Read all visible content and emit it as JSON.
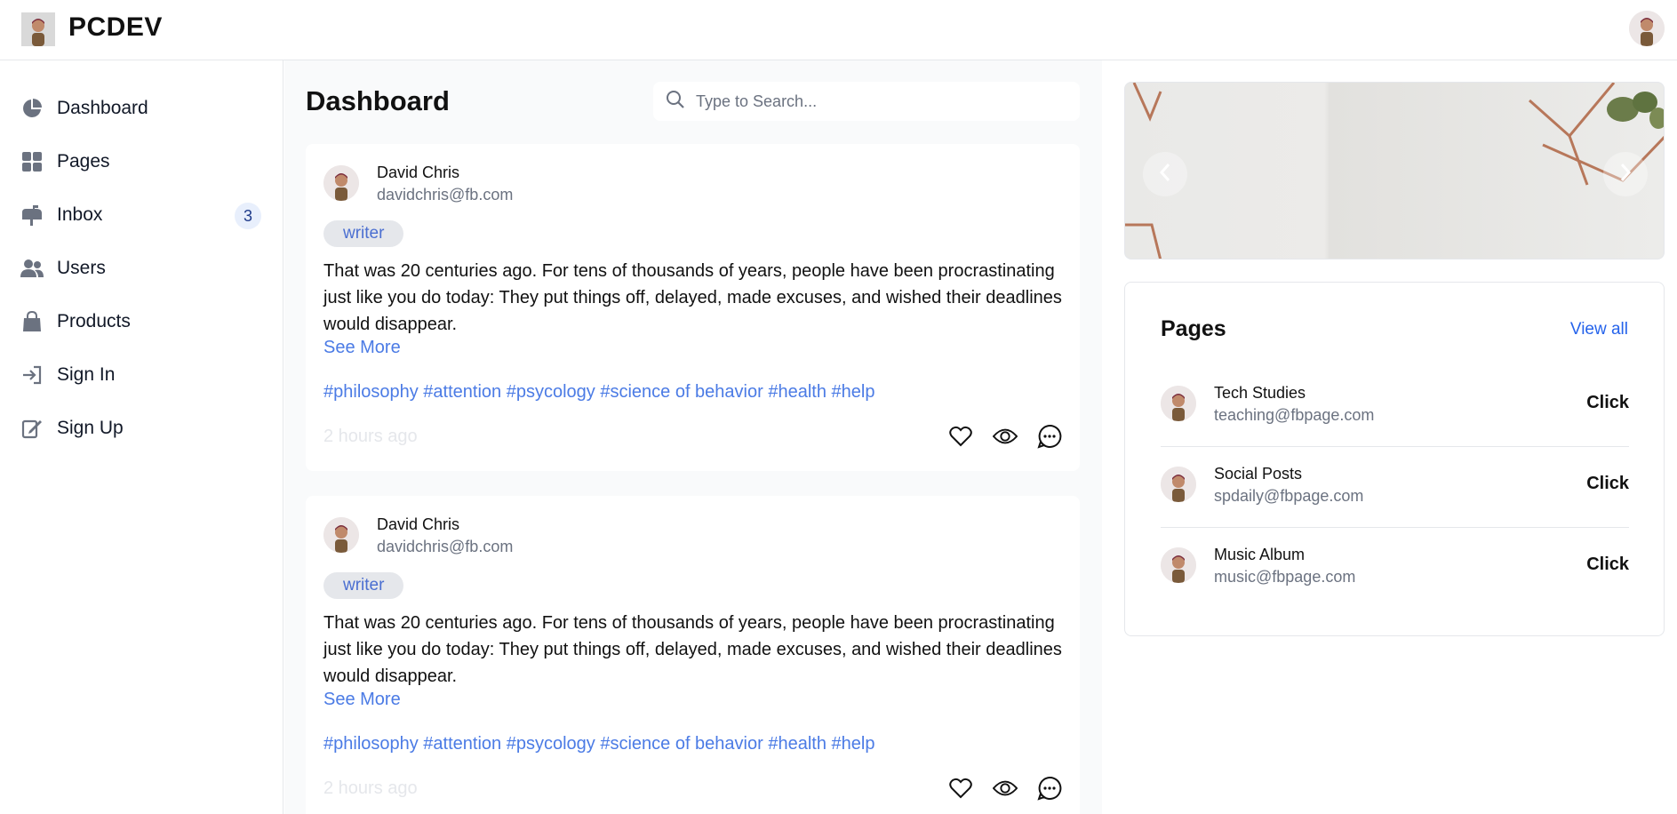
{
  "app": {
    "brand": "PCDEV"
  },
  "sidebar": {
    "items": [
      {
        "label": "Dashboard",
        "icon": "pie-chart-icon"
      },
      {
        "label": "Pages",
        "icon": "grid-icon"
      },
      {
        "label": "Inbox",
        "icon": "mailbox-icon",
        "badge": "3"
      },
      {
        "label": "Users",
        "icon": "users-icon"
      },
      {
        "label": "Products",
        "icon": "shopping-bag-icon"
      },
      {
        "label": "Sign In",
        "icon": "sign-in-icon"
      },
      {
        "label": "Sign Up",
        "icon": "sign-up-icon"
      }
    ]
  },
  "main": {
    "title": "Dashboard",
    "search": {
      "placeholder": "Type to Search..."
    },
    "posts": [
      {
        "name": "David Chris",
        "email": "davidchris@fb.com",
        "tag": "writer",
        "body": "That was 20 centuries ago. For tens of thousands of years, people have been procrastinating just like you do today: They put things off, delayed, made excuses, and wished their deadlines would disappear.",
        "see_more": "See More",
        "hashtags": "#philosophy #attention #psycology #science of behavior #health #help",
        "time": "2 hours ago"
      },
      {
        "name": "David Chris",
        "email": "davidchris@fb.com",
        "tag": "writer",
        "body": "That was 20 centuries ago. For tens of thousands of years, people have been procrastinating just like you do today: They put things off, delayed, made excuses, and wished their deadlines would disappear.",
        "see_more": "See More",
        "hashtags": "#philosophy #attention #psycology #science of behavior #health #help",
        "time": "2 hours ago"
      }
    ]
  },
  "pages_card": {
    "title": "Pages",
    "view_all": "View all",
    "items": [
      {
        "name": "Tech Studies",
        "email": "teaching@fbpage.com",
        "action": "Click"
      },
      {
        "name": "Social Posts",
        "email": "spdaily@fbpage.com",
        "action": "Click"
      },
      {
        "name": "Music Album",
        "email": "music@fbpage.com",
        "action": "Click"
      }
    ]
  },
  "colors": {
    "accent": "#4b7be5",
    "link": "#2563eb",
    "icon": "#6b7280",
    "badge_bg": "#e8effc"
  }
}
